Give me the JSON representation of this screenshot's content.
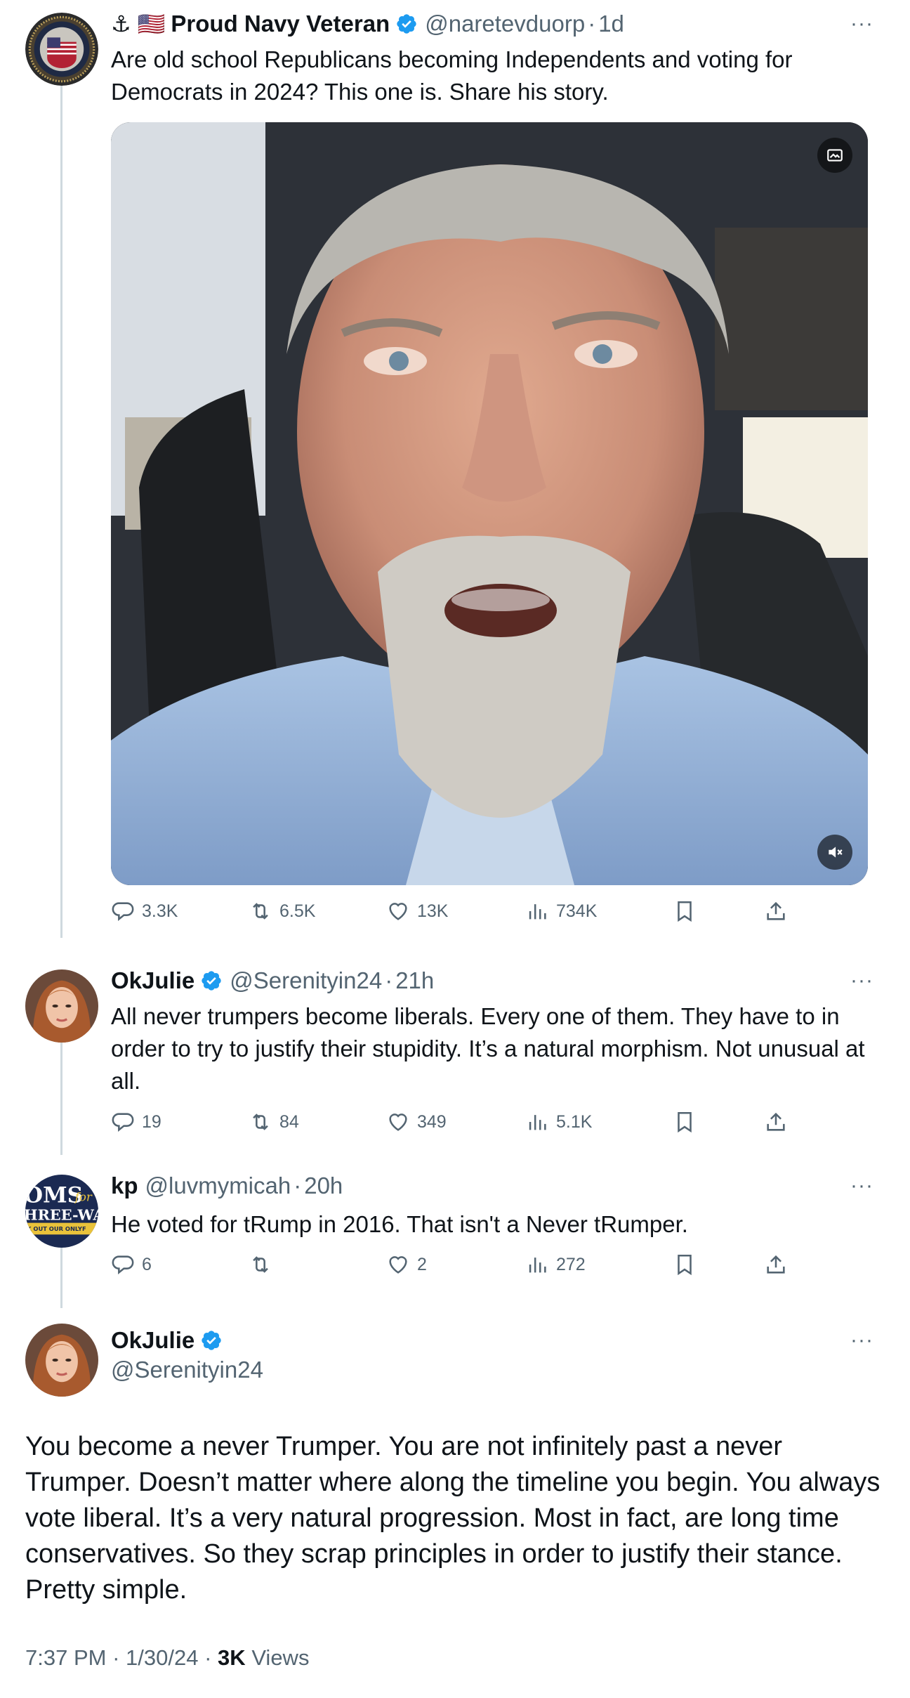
{
  "tweets": [
    {
      "name": "Proud Navy Veteran",
      "prefix_emojis": "⚓ 🇺🇸",
      "handle": "@naretevduorp",
      "time": "1d",
      "text": "Are old school Republicans becoming Independents and voting for Democrats in 2024? This one is. Share his story.",
      "replies": "3.3K",
      "reposts": "6.5K",
      "likes": "13K",
      "views": "734K"
    },
    {
      "name": "OkJulie",
      "handle": "@Serenityin24",
      "time": "21h",
      "text": "All never trumpers become liberals. Every one of them. They have to in order to try to justify their stupidity. It’s a natural morphism. Not unusual at all.",
      "replies": "19",
      "reposts": "84",
      "likes": "349",
      "views": "5.1K"
    },
    {
      "name": "kp",
      "handle": "@luvmymicah",
      "time": "20h",
      "text": "He voted for tRump in 2016. That isn't a Never tRumper.",
      "replies": "6",
      "reposts": "",
      "likes": "2",
      "views": "272",
      "avatar_text_top": "OMS",
      "avatar_text_mid": "HREE-WAY",
      "avatar_text_small": "K OUT OUR ONLYF",
      "avatar_text_for": "for"
    }
  ],
  "main_tweet": {
    "name": "OkJulie",
    "handle": "@Serenityin24",
    "text": "You become a never Trumper. You are not infinitely past a never Trumper. Doesn’t matter where along the timeline you begin. You always vote liberal. It’s a very natural progression.  Most in fact, are long time conservatives. So they scrap principles in order to justify their stance. Pretty simple.",
    "time": "7:37 PM",
    "date": "1/30/24",
    "views_count": "3K",
    "views_label": "Views"
  },
  "ui": {
    "dot": "·",
    "more": "···"
  },
  "colors": {
    "text": "#0f1419",
    "secondary": "#536471",
    "verified": "#1d9bf0",
    "thread_line": "#cfd9de"
  }
}
